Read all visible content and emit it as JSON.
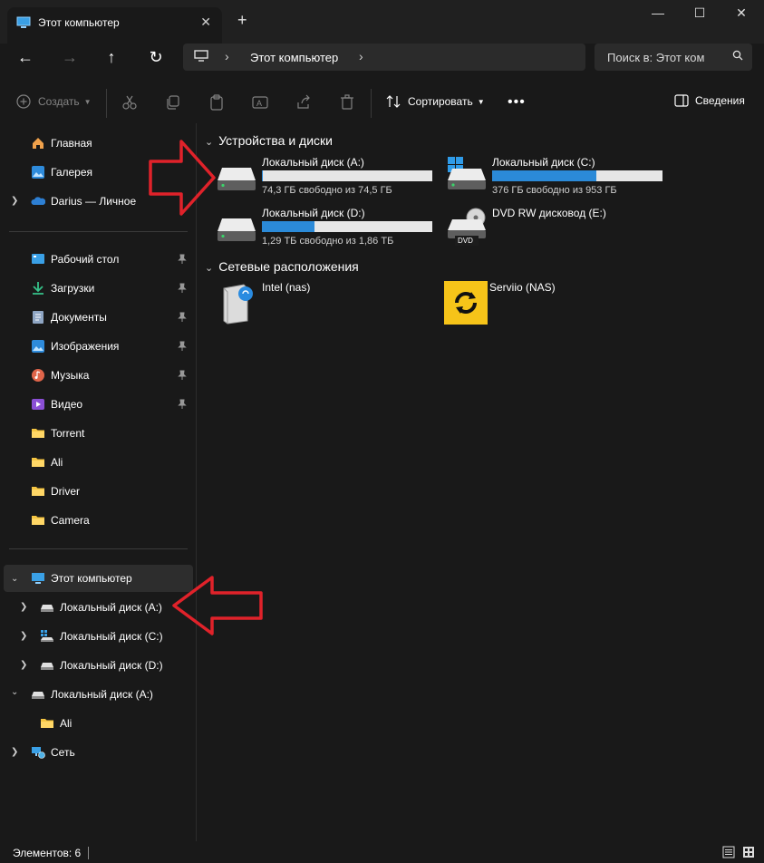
{
  "window": {
    "tab_title": "Этот компьютер",
    "new_tab_icon": "plus-icon",
    "controls": [
      "minimize-icon",
      "maximize-icon",
      "close-icon"
    ]
  },
  "navigation": {
    "address": {
      "root_icon": "computer-icon",
      "crumb": "Этот компьютер"
    },
    "search_placeholder": "Поиск в: Этот ком"
  },
  "toolbar": {
    "create_label": "Создать",
    "sort_label": "Сортировать",
    "details_label": "Сведения",
    "icons": [
      "cut-icon",
      "copy-icon",
      "paste-icon",
      "rename-icon",
      "share-icon",
      "delete-icon"
    ]
  },
  "sidebar": {
    "top": [
      {
        "label": "Главная",
        "icon": "home-icon"
      },
      {
        "label": "Галерея",
        "icon": "gallery-icon"
      },
      {
        "label": "Darius — Личное",
        "icon": "onedrive-icon"
      }
    ],
    "quick": [
      {
        "label": "Рабочий стол",
        "icon": "desktop-icon",
        "pinned": true
      },
      {
        "label": "Загрузки",
        "icon": "download-icon",
        "pinned": true
      },
      {
        "label": "Документы",
        "icon": "documents-icon",
        "pinned": true
      },
      {
        "label": "Изображения",
        "icon": "pictures-icon",
        "pinned": true
      },
      {
        "label": "Музыка",
        "icon": "music-icon",
        "pinned": true
      },
      {
        "label": "Видео",
        "icon": "video-icon",
        "pinned": true
      },
      {
        "label": "Torrent",
        "icon": "folder-icon"
      },
      {
        "label": "Ali",
        "icon": "folder-icon"
      },
      {
        "label": "Driver",
        "icon": "folder-icon"
      },
      {
        "label": "Camera",
        "icon": "folder-icon"
      }
    ],
    "tree": {
      "this_pc": "Этот компьютер",
      "drive_a": "Локальный диск (A:)",
      "drive_c": "Локальный диск (C:)",
      "drive_d": "Локальный диск (D:)",
      "drive_a2": "Локальный диск (A:)",
      "ali": "Ali",
      "network": "Сеть"
    }
  },
  "main": {
    "devices_header": "Устройства и диски",
    "network_header": "Сетевые расположения",
    "drives": [
      {
        "name": "Локальный диск (A:)",
        "free": "74,3 ГБ свободно из 74,5 ГБ",
        "used_fraction": 0.003
      },
      {
        "name": "Локальный диск (C:)",
        "free": "376 ГБ свободно из 953 ГБ",
        "used_fraction": 0.61
      },
      {
        "name": "Локальный диск (D:)",
        "free": "1,29 ТБ свободно из 1,86 ТБ",
        "used_fraction": 0.31
      },
      {
        "name": "DVD RW дисковод (E:)",
        "dvd_label": "DVD"
      }
    ],
    "network": [
      {
        "name": "Intel (nas)",
        "icon": "nas-icon"
      },
      {
        "name": "Serviio (NAS)",
        "icon": "serviio-icon"
      }
    ]
  },
  "status": {
    "items": "Элементов: 6"
  },
  "colors": {
    "background": "#191919",
    "accent": "#2b8ad8",
    "arrow": "#e0222a"
  }
}
